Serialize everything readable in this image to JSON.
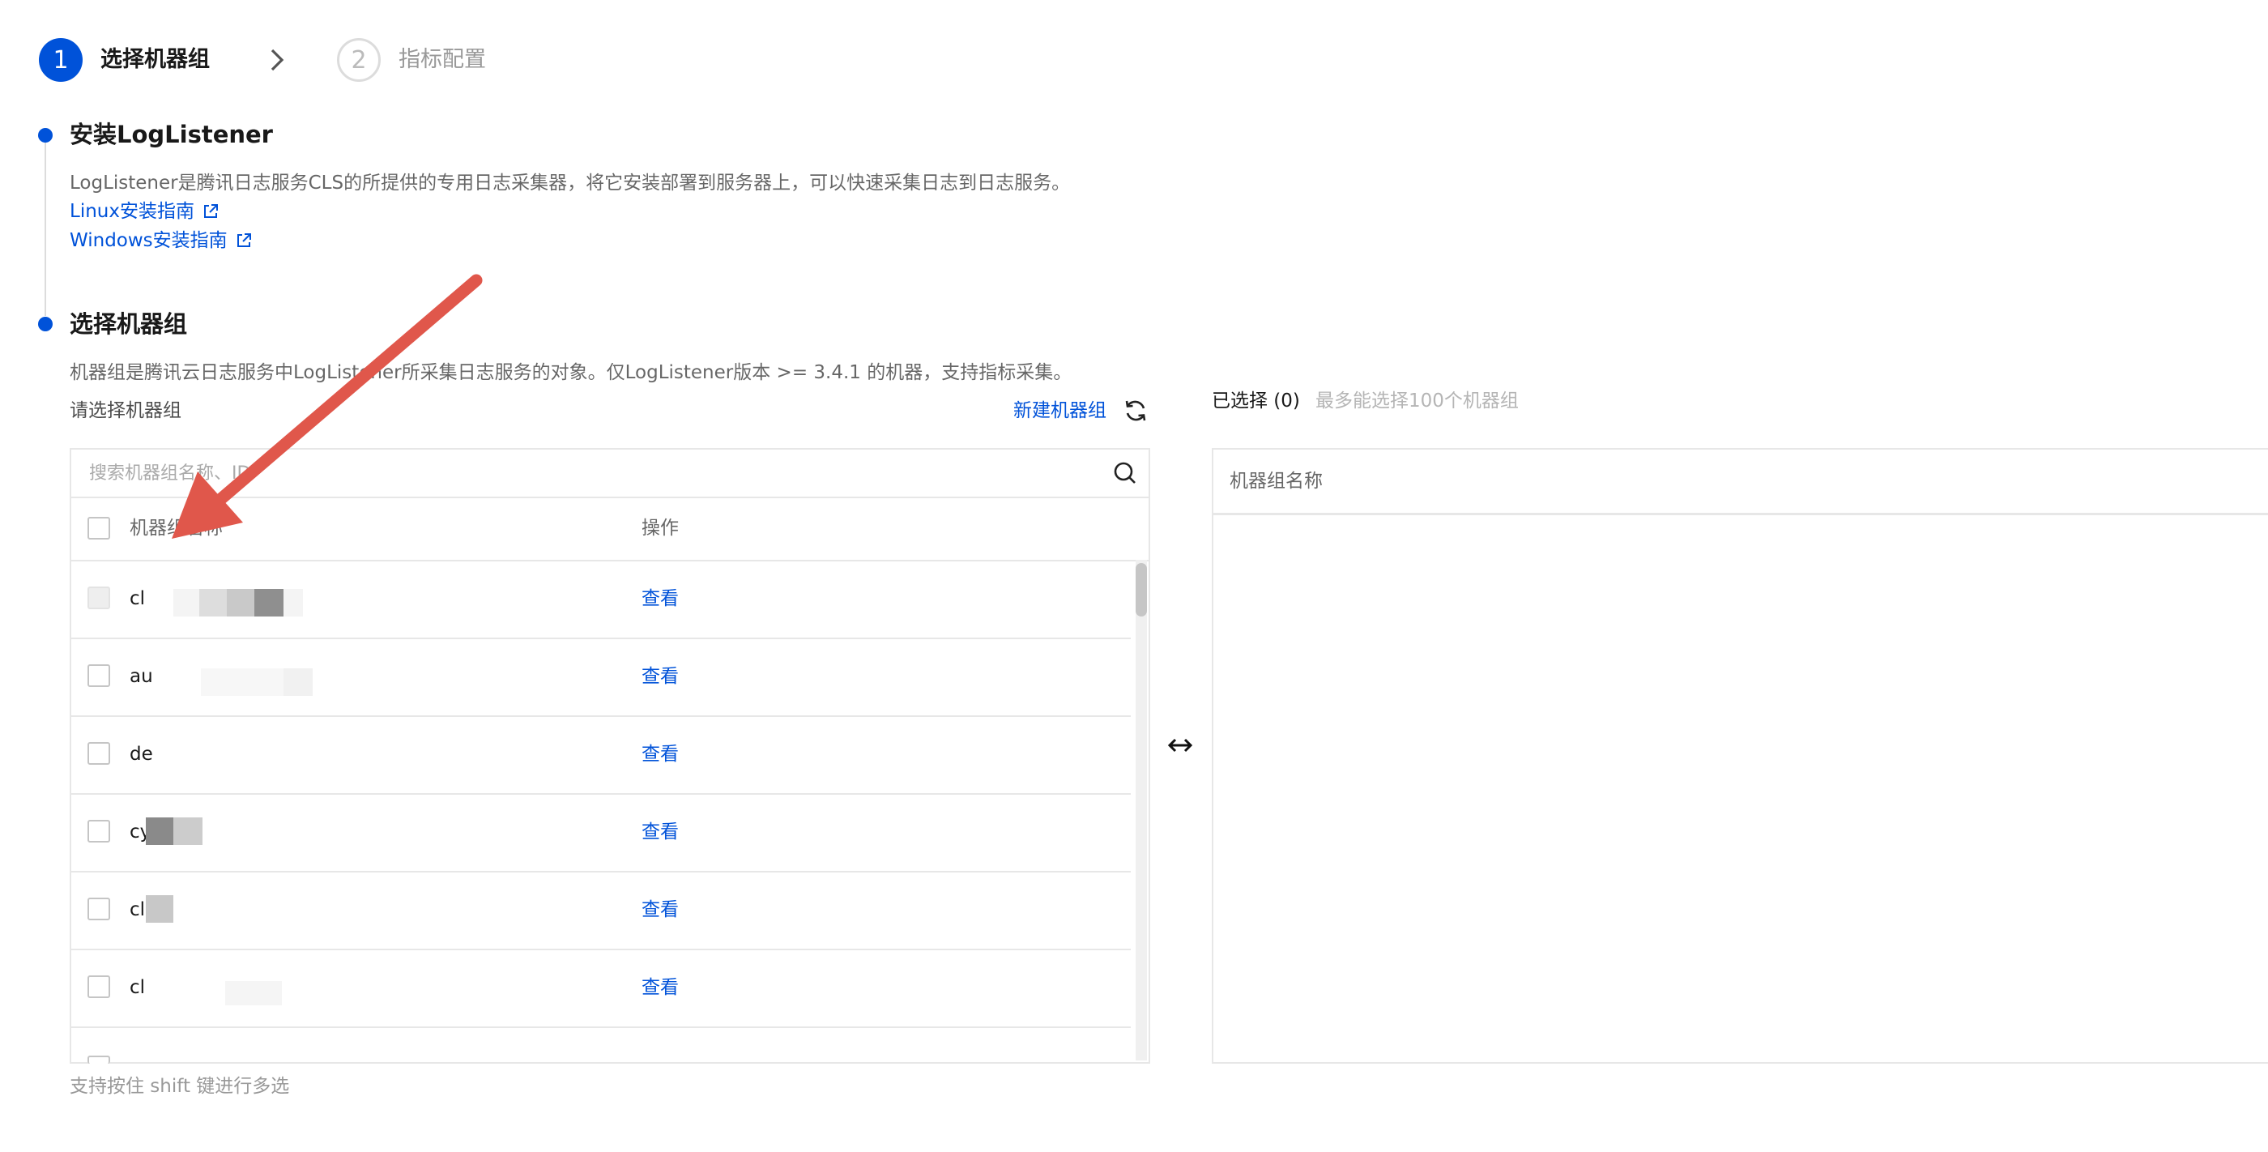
{
  "steps": [
    {
      "number": "1",
      "label": "选择机器组"
    },
    {
      "number": "2",
      "label": "指标配置"
    }
  ],
  "install": {
    "title": "安装LogListener",
    "description": "LogListener是腾讯日志服务CLS的所提供的专用日志采集器，将它安装部署到服务器上，可以快速采集日志到日志服务。",
    "linux_link": "Linux安装指南",
    "windows_link": "Windows安装指南"
  },
  "machine_group": {
    "title": "选择机器组",
    "description": "机器组是腾讯云日志服务中LogListener所采集日志服务的对象。仅LogListener版本 >= 3.4.1 的机器，支持指标采集。",
    "select_label": "请选择机器组",
    "new_group_button": "新建机器组",
    "search_placeholder": "搜索机器组名称、ID",
    "columns": {
      "name": "机器组名称",
      "action": "操作"
    },
    "rows": [
      {
        "name": "cl",
        "action": "查看",
        "disabled": true
      },
      {
        "name": "au",
        "action": "查看",
        "disabled": false
      },
      {
        "name": "de",
        "action": "查看",
        "disabled": false
      },
      {
        "name": "cy",
        "action": "查看",
        "disabled": false
      },
      {
        "name": "cl",
        "action": "查看",
        "disabled": false
      },
      {
        "name": "cl",
        "action": "查看",
        "disabled": false
      }
    ],
    "hint": "支持按住 shift 键进行多选"
  },
  "selected": {
    "label": "已选择 (0)",
    "limit_hint": "最多能选择100个机器组",
    "column": "机器组名称"
  },
  "colors": {
    "primary": "#0052d9",
    "border": "#e7e7e7",
    "annotation_arrow": "#e0574b"
  },
  "icons": {
    "step_arrow": "chevron-right-icon",
    "external_link": "external-link-icon",
    "refresh": "refresh-icon",
    "search": "search-icon",
    "transfer": "transfer-icon"
  }
}
